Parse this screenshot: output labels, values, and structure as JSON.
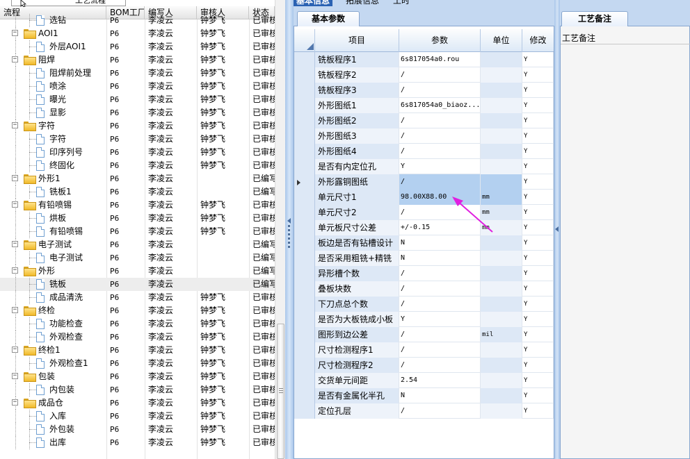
{
  "popup": {
    "label": "工艺流程"
  },
  "top_tabs": [
    "基本信息",
    "拓展信息",
    "工时"
  ],
  "tree": {
    "columns": [
      "流程",
      "BOM工厂",
      "编写人",
      "审核人",
      "状态"
    ],
    "rows": [
      {
        "level": 2,
        "type": "doc",
        "name": "选钻",
        "bom": "P6",
        "author": "李凌云",
        "reviewer": "钟梦飞",
        "status": "已审核"
      },
      {
        "level": 1,
        "type": "folder",
        "name": "AOI1",
        "bom": "P6",
        "author": "李凌云",
        "reviewer": "钟梦飞",
        "status": "已审核"
      },
      {
        "level": 2,
        "type": "doc",
        "name": "外层AOI1",
        "bom": "P6",
        "author": "李凌云",
        "reviewer": "钟梦飞",
        "status": "已审核"
      },
      {
        "level": 1,
        "type": "folder",
        "name": "阻焊",
        "bom": "P6",
        "author": "李凌云",
        "reviewer": "钟梦飞",
        "status": "已审核"
      },
      {
        "level": 2,
        "type": "doc",
        "name": "阻焊前处理",
        "bom": "P6",
        "author": "李凌云",
        "reviewer": "钟梦飞",
        "status": "已审核"
      },
      {
        "level": 2,
        "type": "doc",
        "name": "喷涂",
        "bom": "P6",
        "author": "李凌云",
        "reviewer": "钟梦飞",
        "status": "已审核"
      },
      {
        "level": 2,
        "type": "doc",
        "name": "曝光",
        "bom": "P6",
        "author": "李凌云",
        "reviewer": "钟梦飞",
        "status": "已审核"
      },
      {
        "level": 2,
        "type": "doc",
        "name": "显影",
        "bom": "P6",
        "author": "李凌云",
        "reviewer": "钟梦飞",
        "status": "已审核"
      },
      {
        "level": 1,
        "type": "folder",
        "name": "字符",
        "bom": "P6",
        "author": "李凌云",
        "reviewer": "钟梦飞",
        "status": "已审核"
      },
      {
        "level": 2,
        "type": "doc",
        "name": "字符",
        "bom": "P6",
        "author": "李凌云",
        "reviewer": "钟梦飞",
        "status": "已审核"
      },
      {
        "level": 2,
        "type": "doc",
        "name": "印序列号",
        "bom": "P6",
        "author": "李凌云",
        "reviewer": "钟梦飞",
        "status": "已审核"
      },
      {
        "level": 2,
        "type": "doc",
        "name": "终固化",
        "bom": "P6",
        "author": "李凌云",
        "reviewer": "钟梦飞",
        "status": "已审核"
      },
      {
        "level": 1,
        "type": "folder",
        "name": "外形1",
        "bom": "P6",
        "author": "李凌云",
        "reviewer": "",
        "status": "已编写"
      },
      {
        "level": 2,
        "type": "doc",
        "name": "铣板1",
        "bom": "P6",
        "author": "李凌云",
        "reviewer": "",
        "status": "已编写"
      },
      {
        "level": 1,
        "type": "folder",
        "name": "有铅喷锡",
        "bom": "P6",
        "author": "李凌云",
        "reviewer": "钟梦飞",
        "status": "已审核"
      },
      {
        "level": 2,
        "type": "doc",
        "name": "烘板",
        "bom": "P6",
        "author": "李凌云",
        "reviewer": "钟梦飞",
        "status": "已审核"
      },
      {
        "level": 2,
        "type": "doc",
        "name": "有铅喷锡",
        "bom": "P6",
        "author": "李凌云",
        "reviewer": "钟梦飞",
        "status": "已审核"
      },
      {
        "level": 1,
        "type": "folder",
        "name": "电子测试",
        "bom": "P6",
        "author": "李凌云",
        "reviewer": "",
        "status": "已编写"
      },
      {
        "level": 2,
        "type": "doc",
        "name": "电子测试",
        "bom": "P6",
        "author": "李凌云",
        "reviewer": "",
        "status": "已编写"
      },
      {
        "level": 1,
        "type": "folder",
        "name": "外形",
        "bom": "P6",
        "author": "李凌云",
        "reviewer": "",
        "status": "已编写"
      },
      {
        "level": 2,
        "type": "doc",
        "name": "铣板",
        "bom": "P6",
        "author": "李凌云",
        "reviewer": "",
        "status": "已编写",
        "selected": true
      },
      {
        "level": 2,
        "type": "doc",
        "name": "成品清洗",
        "bom": "P6",
        "author": "李凌云",
        "reviewer": "钟梦飞",
        "status": "已审核"
      },
      {
        "level": 1,
        "type": "folder",
        "name": "终检",
        "bom": "P6",
        "author": "李凌云",
        "reviewer": "钟梦飞",
        "status": "已审核"
      },
      {
        "level": 2,
        "type": "doc",
        "name": "功能检查",
        "bom": "P6",
        "author": "李凌云",
        "reviewer": "钟梦飞",
        "status": "已审核"
      },
      {
        "level": 2,
        "type": "doc",
        "name": "外观检查",
        "bom": "P6",
        "author": "李凌云",
        "reviewer": "钟梦飞",
        "status": "已审核"
      },
      {
        "level": 1,
        "type": "folder",
        "name": "终检1",
        "bom": "P6",
        "author": "李凌云",
        "reviewer": "钟梦飞",
        "status": "已审核"
      },
      {
        "level": 2,
        "type": "doc",
        "name": "外观检查1",
        "bom": "P6",
        "author": "李凌云",
        "reviewer": "钟梦飞",
        "status": "已审核"
      },
      {
        "level": 1,
        "type": "folder",
        "name": "包装",
        "bom": "P6",
        "author": "李凌云",
        "reviewer": "钟梦飞",
        "status": "已审核"
      },
      {
        "level": 2,
        "type": "doc",
        "name": "内包装",
        "bom": "P6",
        "author": "李凌云",
        "reviewer": "钟梦飞",
        "status": "已审核"
      },
      {
        "level": 1,
        "type": "folder",
        "name": "成品仓",
        "bom": "P6",
        "author": "李凌云",
        "reviewer": "钟梦飞",
        "status": "已审核"
      },
      {
        "level": 2,
        "type": "doc",
        "name": "入库",
        "bom": "P6",
        "author": "李凌云",
        "reviewer": "钟梦飞",
        "status": "已审核"
      },
      {
        "level": 2,
        "type": "doc",
        "name": "外包装",
        "bom": "P6",
        "author": "李凌云",
        "reviewer": "钟梦飞",
        "status": "已审核"
      },
      {
        "level": 2,
        "type": "doc",
        "name": "出库",
        "bom": "P6",
        "author": "李凌云",
        "reviewer": "钟梦飞",
        "status": "已审核"
      }
    ]
  },
  "basic": {
    "tab_label": "基本参数",
    "columns": [
      "项目",
      "参数",
      "单位",
      "修改"
    ],
    "rows": [
      {
        "item": "铣板程序1",
        "param": "6s817054a0.rou",
        "unit": "",
        "mod": "Y"
      },
      {
        "item": "铣板程序2",
        "param": "/",
        "unit": "",
        "mod": "Y"
      },
      {
        "item": "铣板程序3",
        "param": "/",
        "unit": "",
        "mod": "Y"
      },
      {
        "item": "外形图纸1",
        "param": "6s817054a0_biaoz...",
        "unit": "",
        "mod": "Y"
      },
      {
        "item": "外形图纸2",
        "param": "/",
        "unit": "",
        "mod": "Y"
      },
      {
        "item": "外形图纸3",
        "param": "/",
        "unit": "",
        "mod": "Y"
      },
      {
        "item": "外形图纸4",
        "param": "/",
        "unit": "",
        "mod": "Y"
      },
      {
        "item": "是否有内定位孔",
        "param": "Y",
        "unit": "",
        "mod": "Y"
      },
      {
        "item": "外形露铜图纸",
        "param": "/",
        "unit": "",
        "mod": "Y",
        "current": true
      },
      {
        "item": "单元尺寸1",
        "param": "98.00X88.00",
        "unit": "mm",
        "mod": "Y",
        "highlight": true
      },
      {
        "item": "单元尺寸2",
        "param": "/",
        "unit": "mm",
        "mod": "Y"
      },
      {
        "item": "单元板尺寸公差",
        "param": "+/-0.15",
        "unit": "mm",
        "mod": "Y"
      },
      {
        "item": "板边是否有钻槽设计",
        "param": "N",
        "unit": "",
        "mod": "Y"
      },
      {
        "item": "是否采用粗铣+精铣",
        "param": "N",
        "unit": "",
        "mod": "Y"
      },
      {
        "item": "异形槽个数",
        "param": "/",
        "unit": "",
        "mod": "Y"
      },
      {
        "item": "叠板块数",
        "param": "/",
        "unit": "",
        "mod": "Y"
      },
      {
        "item": "下刀点总个数",
        "param": "/",
        "unit": "",
        "mod": "Y"
      },
      {
        "item": "是否为大板铣成小板",
        "param": "Y",
        "unit": "",
        "mod": "Y"
      },
      {
        "item": "图形到边公差",
        "param": "/",
        "unit": "mil",
        "mod": "Y"
      },
      {
        "item": "尺寸检测程序1",
        "param": "/",
        "unit": "",
        "mod": "Y"
      },
      {
        "item": "尺寸检测程序2",
        "param": "/",
        "unit": "",
        "mod": "Y"
      },
      {
        "item": "交货单元间距",
        "param": "2.54",
        "unit": "",
        "mod": "Y"
      },
      {
        "item": "是否有金属化半孔",
        "param": "N",
        "unit": "",
        "mod": "Y"
      },
      {
        "item": "定位孔层",
        "param": "/",
        "unit": "",
        "mod": "Y"
      }
    ]
  },
  "note": {
    "tab_label": "工艺备注",
    "field_label": "工艺备注"
  },
  "colors": {
    "accent": "#c4d8f1",
    "annotation_arrow": "#e020e0",
    "selection": "#b3d0f0"
  }
}
